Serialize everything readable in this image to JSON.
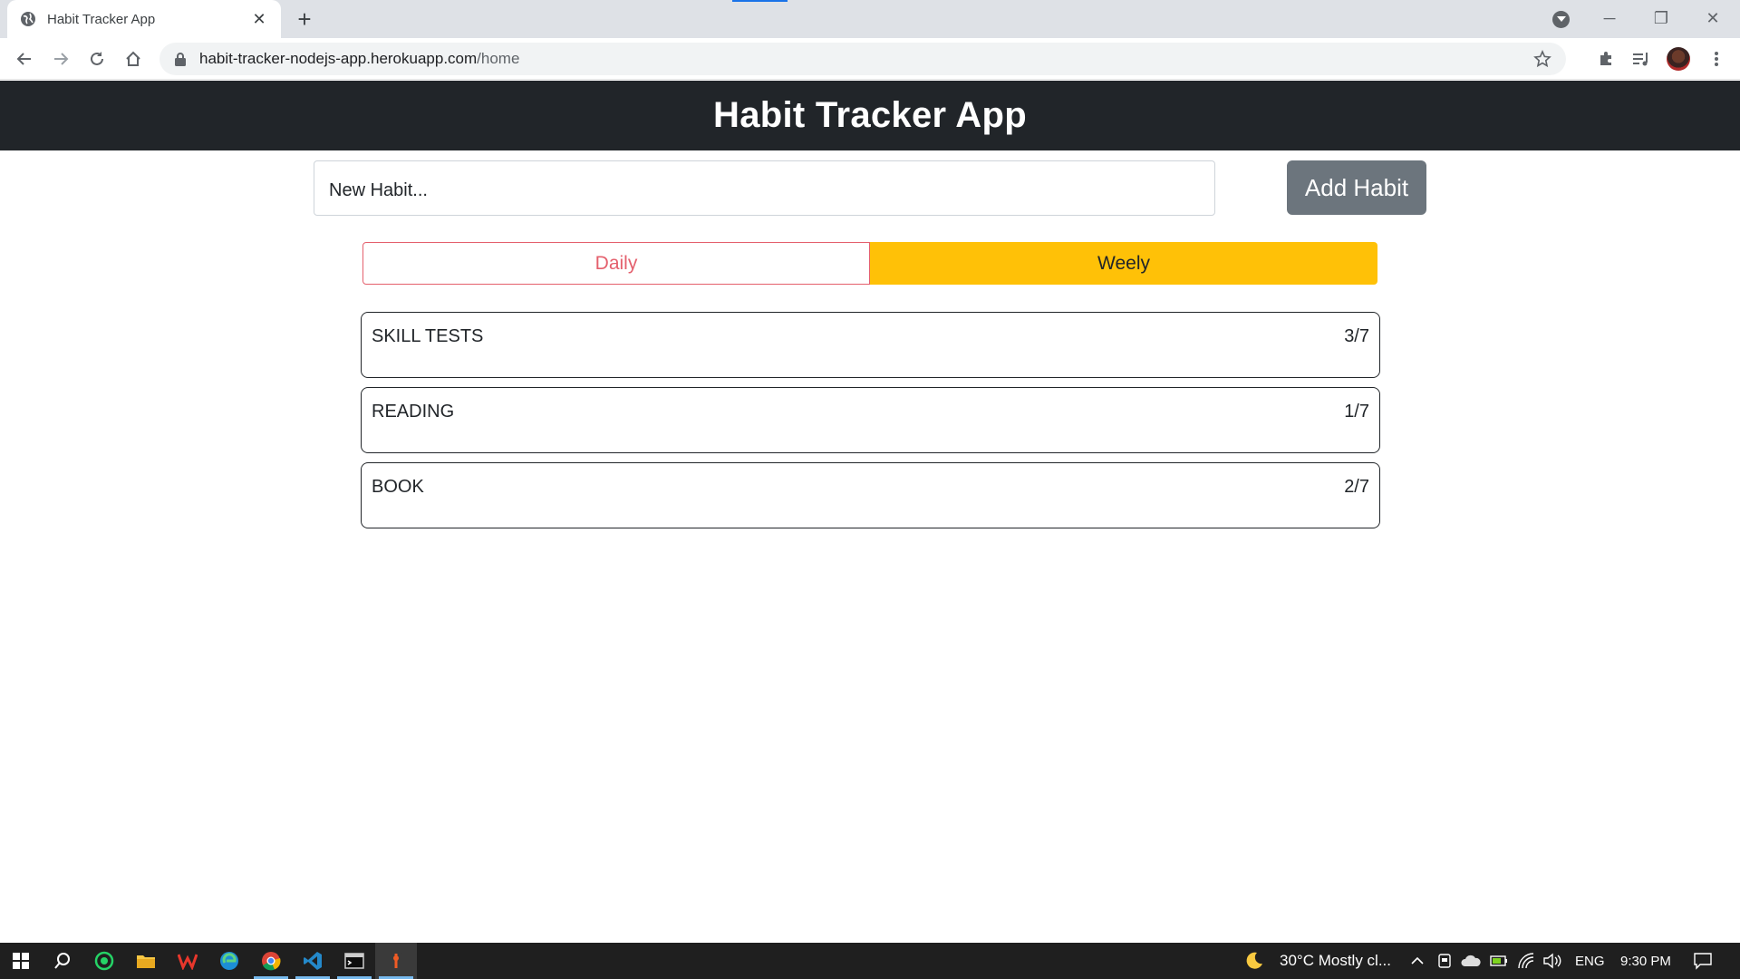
{
  "browser": {
    "tab_title": "Habit Tracker App",
    "tab_close": "✕",
    "new_tab": "+",
    "url_host": "habit-tracker-nodejs-app.herokuapp.com",
    "url_path": "/home",
    "window_minimize": "─",
    "window_restore": "❐",
    "window_close": "✕"
  },
  "app": {
    "title": "Habit Tracker App",
    "input_placeholder": "New Habit...",
    "add_button": "Add Habit",
    "toggle_daily": "Daily",
    "toggle_weekly": "Weely",
    "colors": {
      "header_bg": "#212529",
      "add_button_bg": "#6c757d",
      "daily_outline": "#e4606d",
      "weekly_bg": "#ffc107"
    }
  },
  "habits": [
    {
      "name": "SKILL TESTS",
      "count": "3/7"
    },
    {
      "name": "READING",
      "count": "1/7"
    },
    {
      "name": "BOOK",
      "count": "2/7"
    }
  ],
  "taskbar": {
    "weather": "30°C  Mostly cl...",
    "language": "ENG",
    "time": "9:30 PM",
    "icons": [
      "windows-start-icon",
      "search-icon",
      "whatsapp-icon",
      "file-explorer-icon",
      "wps-office-icon",
      "edge-icon",
      "chrome-icon",
      "vscode-icon",
      "terminal-icon",
      "postman-icon"
    ]
  }
}
